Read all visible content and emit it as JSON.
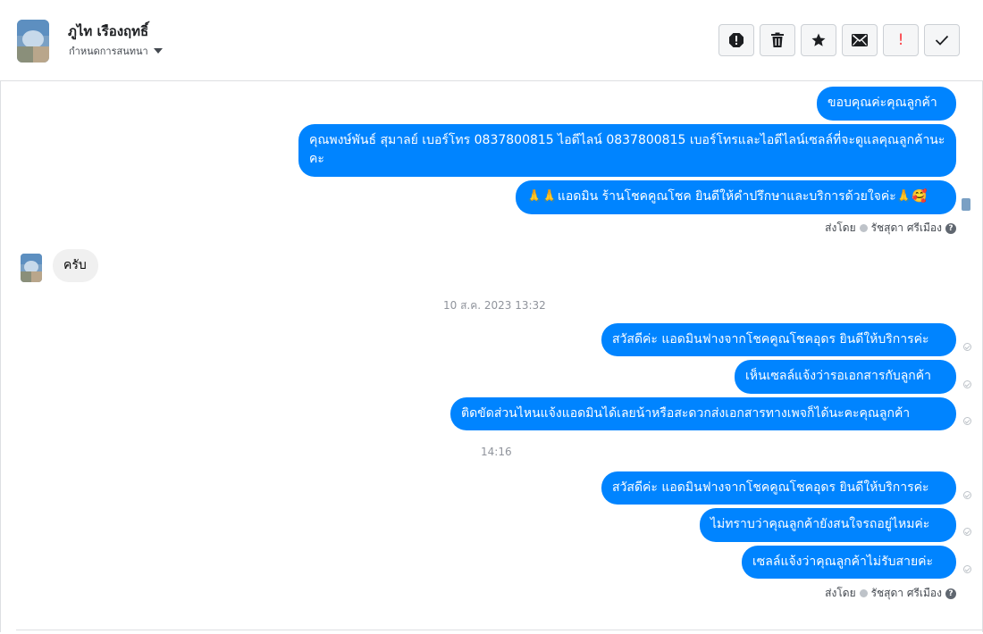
{
  "header": {
    "contact_name": "ภูไท เรืองฤทธิ์",
    "assign_label": "กำหนดการสนทนา",
    "actions": [
      {
        "name": "report-spam-icon"
      },
      {
        "name": "trash-icon"
      },
      {
        "name": "star-icon"
      },
      {
        "name": "envelope-icon"
      },
      {
        "name": "priority-icon",
        "label": "!"
      },
      {
        "name": "checkmark-icon"
      }
    ]
  },
  "messages": [
    {
      "text": "ขอบคุณค่ะคุณลูกค้า"
    },
    {
      "text": "คุณพงษ์พันธ์ สุมาลย์      เบอร์โทร 0837800815  ไอดีไลน์ 0837800815   เบอร์โทรและไอดีไลน์เซลล์ที่จะดูแลคุณลูกค้านะคะ"
    },
    {
      "text": "🙏🙏แอดมิน ร้านโชคคูณโชค ยินดีให้คำปรึกษาและบริการด้วยใจค่ะ🙏🥰"
    },
    {
      "sent_by_prefix": "ส่งโดย",
      "sent_by_name": "รัชสุดา ศรีเมือง",
      "help": "?"
    },
    {
      "incoming": "ครับ"
    },
    {
      "timestamp": "10 ส.ค. 2023 13:32"
    },
    {
      "text": "สวัสดีค่ะ แอดมินฟางจากโชคคูณโชคอุดร ยินดีให้บริการค่ะ"
    },
    {
      "text": "เห็นเซลล์แจ้งว่ารอเอกสารกับลูกค้า"
    },
    {
      "text": "ติดขัดส่วนไหนแจ้งแอดมินได้เลยน้าหรือสะดวกส่งเอกสารทางเพจก็ได้นะคะคุณลูกค้า"
    },
    {
      "timestamp": "14:16"
    },
    {
      "text": "สวัสดีค่ะ แอดมินฟางจากโชคคูณโชคอุดร ยินดีให้บริการค่ะ"
    },
    {
      "text": "ไม่ทราบว่าคุณลูกค้ายังสนใจรถอยู่ไหมค่ะ"
    },
    {
      "text": "เซลล์แจ้งว่าคุณลูกค้าไม่รับสายค่ะ"
    },
    {
      "sent_by_prefix": "ส่งโดย",
      "sent_by_name": "รัชสุดา ศรีเมือง",
      "help": "?"
    }
  ],
  "colors": {
    "outgoing_bubble": "#0084ff",
    "incoming_bubble": "#f0f0f0",
    "priority": "#fa383e"
  }
}
